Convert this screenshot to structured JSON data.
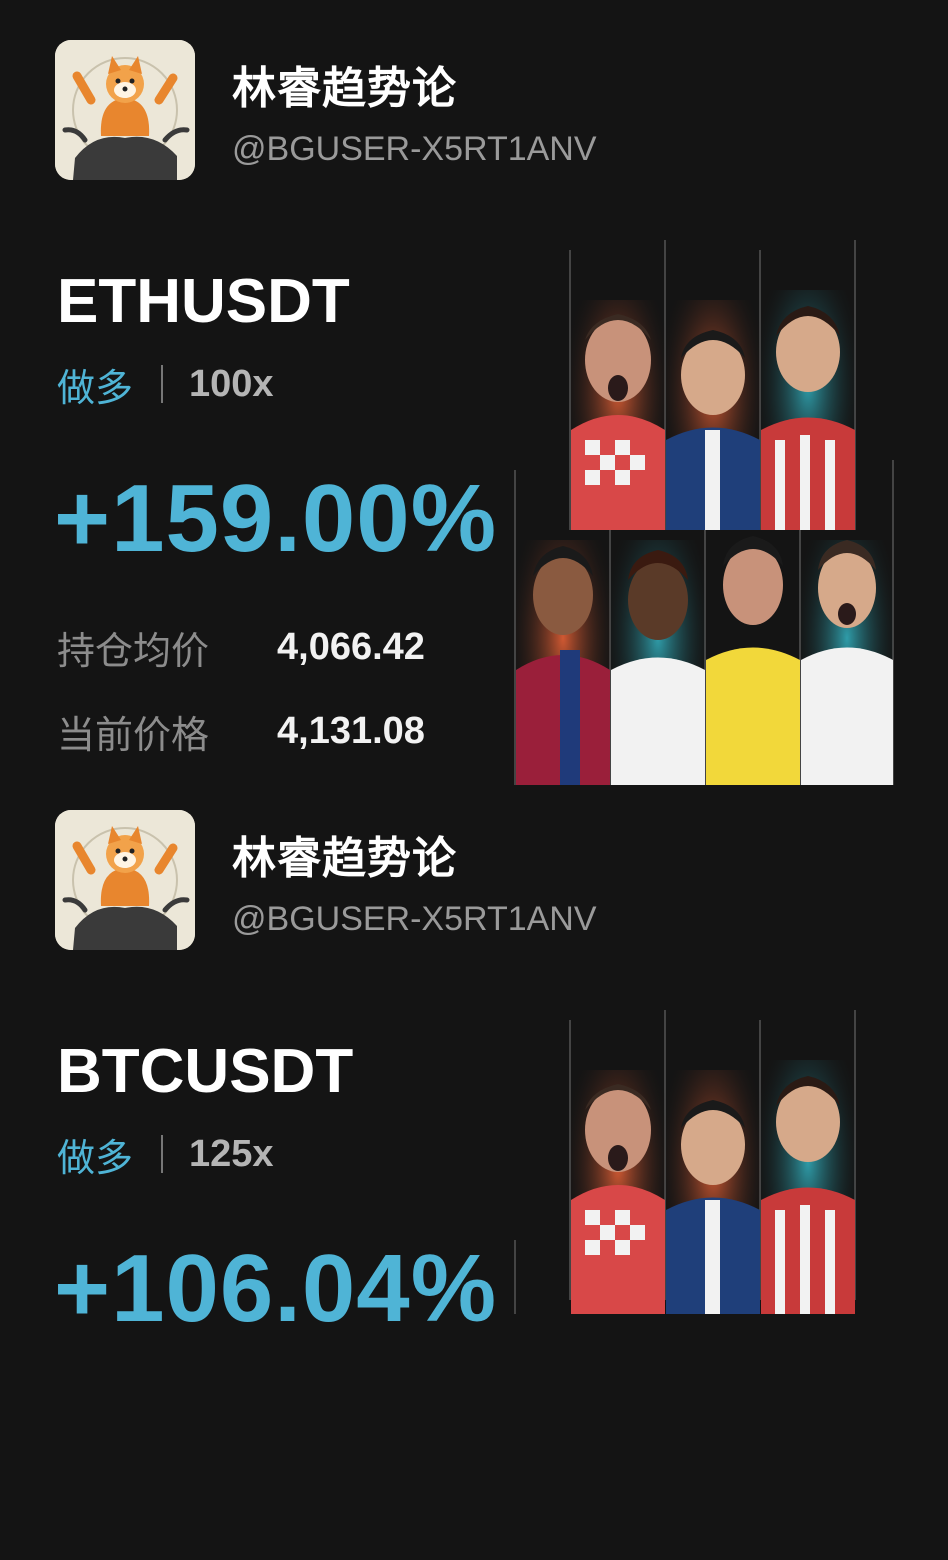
{
  "cards": [
    {
      "user": {
        "name": "林睿趋势论",
        "handle": "@BGUSER-X5RT1ANV",
        "avatar_icon": "shiba-riding-bull-icon"
      },
      "symbol": "ETHUSDT",
      "direction": "做多",
      "leverage": "100x",
      "pnl": "+159.00%",
      "avg_price_label": "持仓均价",
      "avg_price": "4,066.42",
      "current_price_label": "当前价格",
      "current_price": "4,131.08"
    },
    {
      "user": {
        "name": "林睿趋势论",
        "handle": "@BGUSER-X5RT1ANV",
        "avatar_icon": "shiba-riding-bull-icon"
      },
      "symbol": "BTCUSDT",
      "direction": "做多",
      "leverage": "125x",
      "pnl": "+106.04%"
    }
  ],
  "colors": {
    "background": "#141414",
    "accent": "#4fb4d6",
    "muted": "#8c8c8c"
  }
}
